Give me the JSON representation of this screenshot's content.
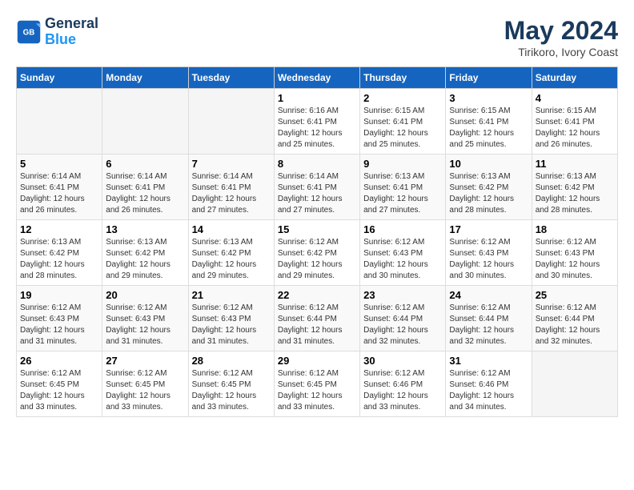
{
  "logo": {
    "line1": "General",
    "line2": "Blue"
  },
  "title": "May 2024",
  "location": "Tirikoro, Ivory Coast",
  "days_header": [
    "Sunday",
    "Monday",
    "Tuesday",
    "Wednesday",
    "Thursday",
    "Friday",
    "Saturday"
  ],
  "weeks": [
    [
      {
        "day": "",
        "info": ""
      },
      {
        "day": "",
        "info": ""
      },
      {
        "day": "",
        "info": ""
      },
      {
        "day": "1",
        "info": "Sunrise: 6:16 AM\nSunset: 6:41 PM\nDaylight: 12 hours\nand 25 minutes."
      },
      {
        "day": "2",
        "info": "Sunrise: 6:15 AM\nSunset: 6:41 PM\nDaylight: 12 hours\nand 25 minutes."
      },
      {
        "day": "3",
        "info": "Sunrise: 6:15 AM\nSunset: 6:41 PM\nDaylight: 12 hours\nand 25 minutes."
      },
      {
        "day": "4",
        "info": "Sunrise: 6:15 AM\nSunset: 6:41 PM\nDaylight: 12 hours\nand 26 minutes."
      }
    ],
    [
      {
        "day": "5",
        "info": "Sunrise: 6:14 AM\nSunset: 6:41 PM\nDaylight: 12 hours\nand 26 minutes."
      },
      {
        "day": "6",
        "info": "Sunrise: 6:14 AM\nSunset: 6:41 PM\nDaylight: 12 hours\nand 26 minutes."
      },
      {
        "day": "7",
        "info": "Sunrise: 6:14 AM\nSunset: 6:41 PM\nDaylight: 12 hours\nand 27 minutes."
      },
      {
        "day": "8",
        "info": "Sunrise: 6:14 AM\nSunset: 6:41 PM\nDaylight: 12 hours\nand 27 minutes."
      },
      {
        "day": "9",
        "info": "Sunrise: 6:13 AM\nSunset: 6:41 PM\nDaylight: 12 hours\nand 27 minutes."
      },
      {
        "day": "10",
        "info": "Sunrise: 6:13 AM\nSunset: 6:42 PM\nDaylight: 12 hours\nand 28 minutes."
      },
      {
        "day": "11",
        "info": "Sunrise: 6:13 AM\nSunset: 6:42 PM\nDaylight: 12 hours\nand 28 minutes."
      }
    ],
    [
      {
        "day": "12",
        "info": "Sunrise: 6:13 AM\nSunset: 6:42 PM\nDaylight: 12 hours\nand 28 minutes."
      },
      {
        "day": "13",
        "info": "Sunrise: 6:13 AM\nSunset: 6:42 PM\nDaylight: 12 hours\nand 29 minutes."
      },
      {
        "day": "14",
        "info": "Sunrise: 6:13 AM\nSunset: 6:42 PM\nDaylight: 12 hours\nand 29 minutes."
      },
      {
        "day": "15",
        "info": "Sunrise: 6:12 AM\nSunset: 6:42 PM\nDaylight: 12 hours\nand 29 minutes."
      },
      {
        "day": "16",
        "info": "Sunrise: 6:12 AM\nSunset: 6:43 PM\nDaylight: 12 hours\nand 30 minutes."
      },
      {
        "day": "17",
        "info": "Sunrise: 6:12 AM\nSunset: 6:43 PM\nDaylight: 12 hours\nand 30 minutes."
      },
      {
        "day": "18",
        "info": "Sunrise: 6:12 AM\nSunset: 6:43 PM\nDaylight: 12 hours\nand 30 minutes."
      }
    ],
    [
      {
        "day": "19",
        "info": "Sunrise: 6:12 AM\nSunset: 6:43 PM\nDaylight: 12 hours\nand 31 minutes."
      },
      {
        "day": "20",
        "info": "Sunrise: 6:12 AM\nSunset: 6:43 PM\nDaylight: 12 hours\nand 31 minutes."
      },
      {
        "day": "21",
        "info": "Sunrise: 6:12 AM\nSunset: 6:43 PM\nDaylight: 12 hours\nand 31 minutes."
      },
      {
        "day": "22",
        "info": "Sunrise: 6:12 AM\nSunset: 6:44 PM\nDaylight: 12 hours\nand 31 minutes."
      },
      {
        "day": "23",
        "info": "Sunrise: 6:12 AM\nSunset: 6:44 PM\nDaylight: 12 hours\nand 32 minutes."
      },
      {
        "day": "24",
        "info": "Sunrise: 6:12 AM\nSunset: 6:44 PM\nDaylight: 12 hours\nand 32 minutes."
      },
      {
        "day": "25",
        "info": "Sunrise: 6:12 AM\nSunset: 6:44 PM\nDaylight: 12 hours\nand 32 minutes."
      }
    ],
    [
      {
        "day": "26",
        "info": "Sunrise: 6:12 AM\nSunset: 6:45 PM\nDaylight: 12 hours\nand 33 minutes."
      },
      {
        "day": "27",
        "info": "Sunrise: 6:12 AM\nSunset: 6:45 PM\nDaylight: 12 hours\nand 33 minutes."
      },
      {
        "day": "28",
        "info": "Sunrise: 6:12 AM\nSunset: 6:45 PM\nDaylight: 12 hours\nand 33 minutes."
      },
      {
        "day": "29",
        "info": "Sunrise: 6:12 AM\nSunset: 6:45 PM\nDaylight: 12 hours\nand 33 minutes."
      },
      {
        "day": "30",
        "info": "Sunrise: 6:12 AM\nSunset: 6:46 PM\nDaylight: 12 hours\nand 33 minutes."
      },
      {
        "day": "31",
        "info": "Sunrise: 6:12 AM\nSunset: 6:46 PM\nDaylight: 12 hours\nand 34 minutes."
      },
      {
        "day": "",
        "info": ""
      }
    ]
  ]
}
